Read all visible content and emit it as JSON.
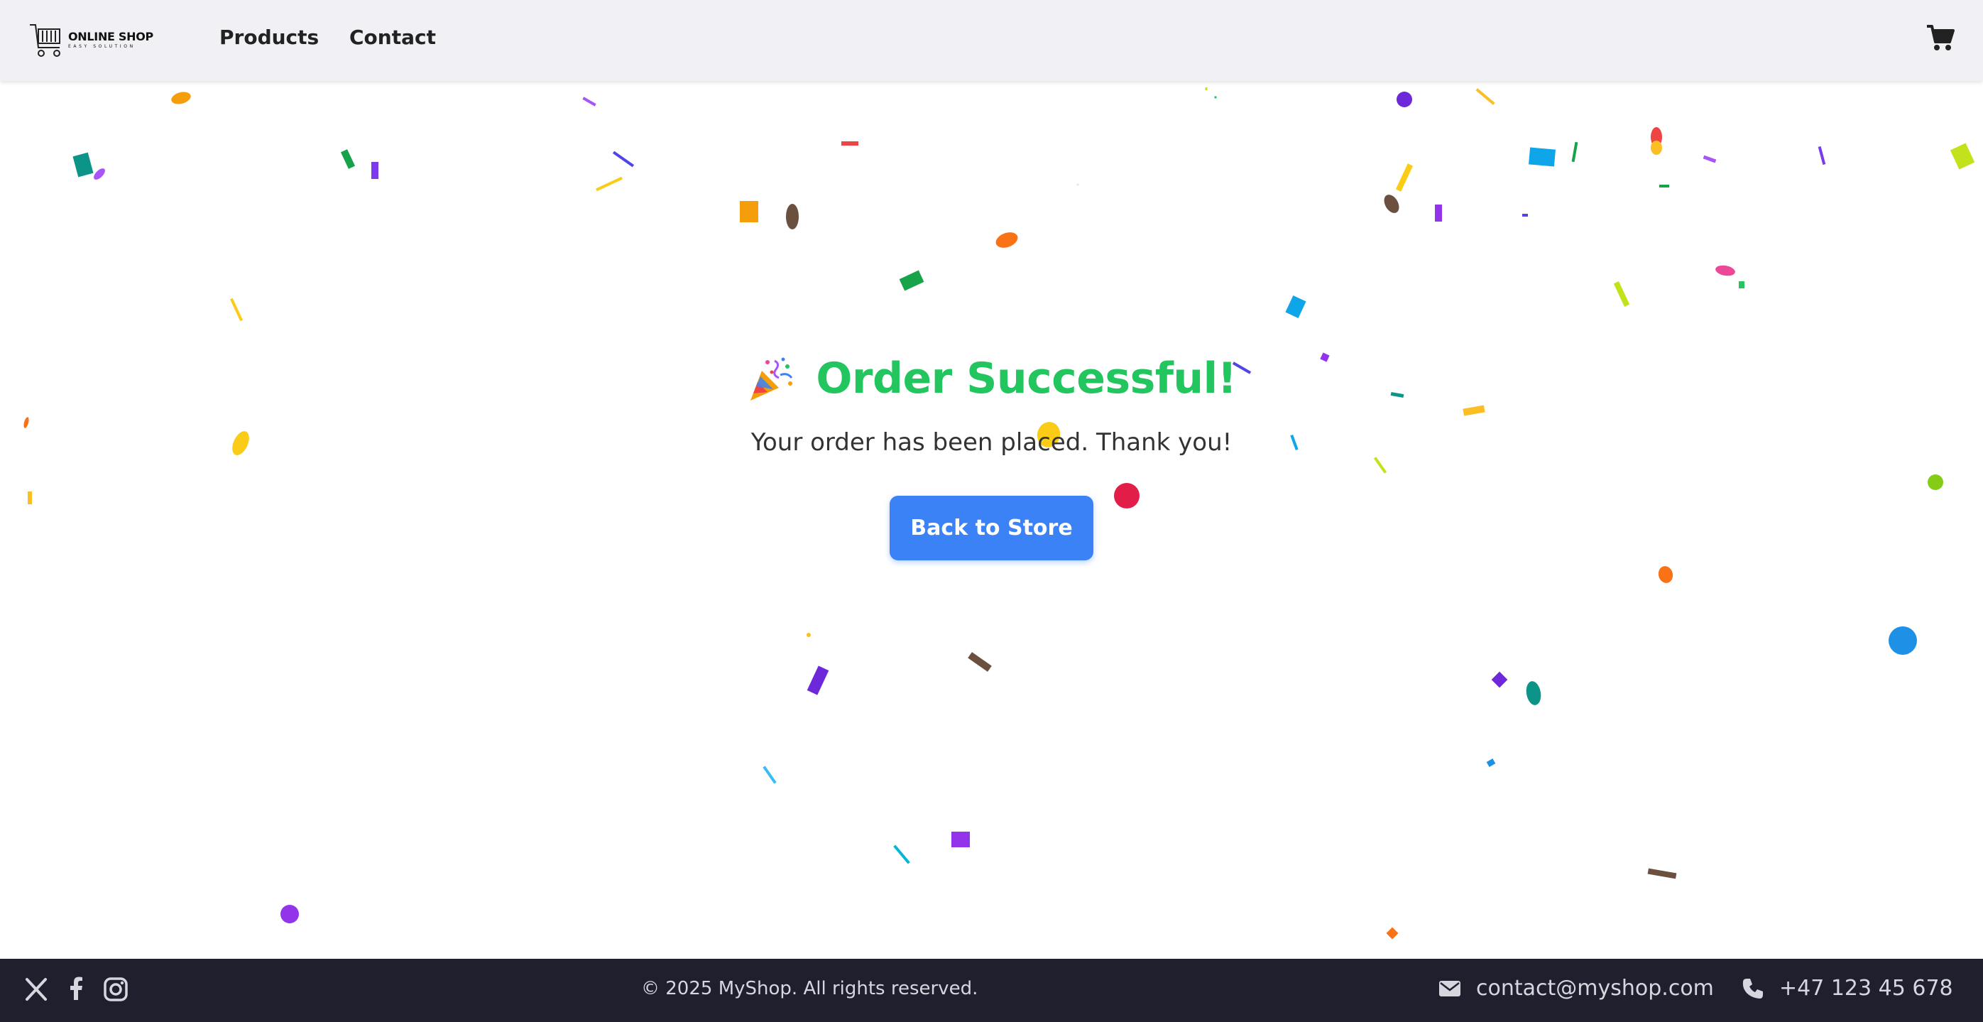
{
  "header": {
    "logo": {
      "title": "ONLINE SHOP",
      "subtitle": "EASY SOLUTION"
    },
    "nav": [
      {
        "label": "Products"
      },
      {
        "label": "Contact"
      }
    ],
    "cart_icon": "shopping-cart-icon"
  },
  "main": {
    "title_icon": "party-popper-icon",
    "title": "Order Successful!",
    "message": "Your order has been placed. Thank you!",
    "button_label": "Back to Store"
  },
  "footer": {
    "social_icons": [
      "x-twitter-icon",
      "facebook-icon",
      "instagram-icon"
    ],
    "copyright": "© 2025 MyShop. All rights reserved.",
    "email": "contact@myshop.com",
    "phone": "+47 123 45 678"
  },
  "colors": {
    "header_bg": "#f0f0f5",
    "title": "#22c55e",
    "button": "#3b82f6",
    "footer_bg": "#1f1f2e"
  }
}
